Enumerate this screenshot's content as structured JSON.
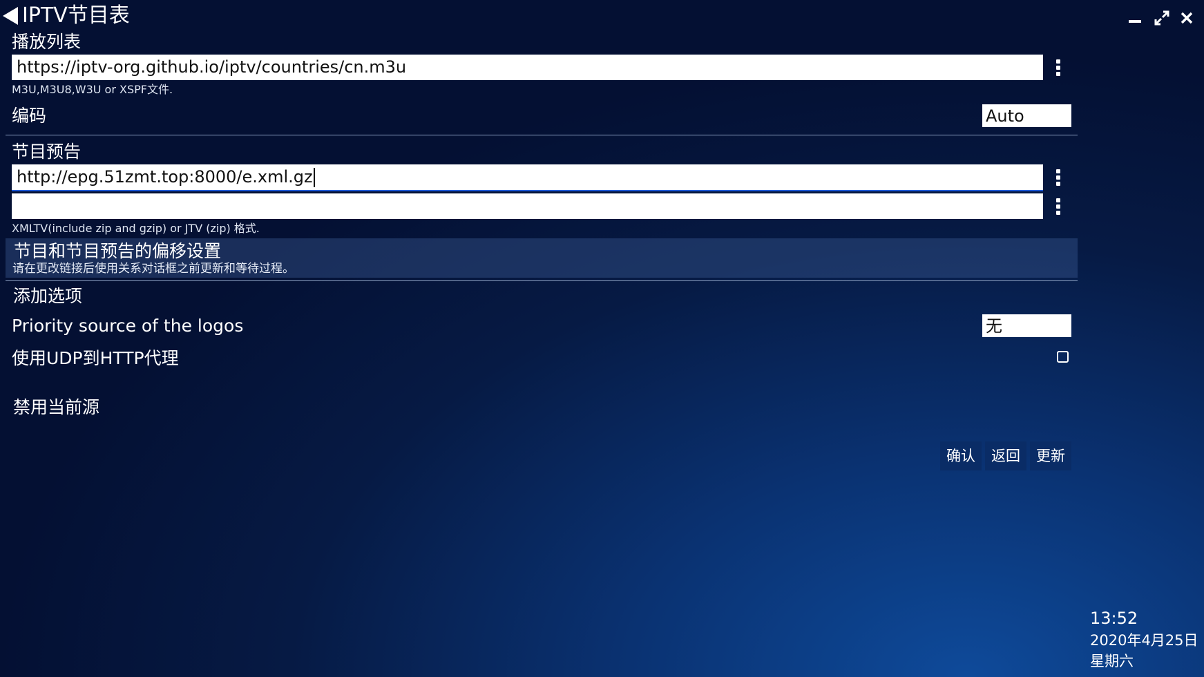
{
  "window": {
    "title": "IPTV节目表",
    "controls": [
      "minimize",
      "maximize",
      "close"
    ]
  },
  "playlist": {
    "label": "播放列表",
    "url": "https://iptv-org.github.io/iptv/countries/cn.m3u",
    "hint": "M3U,M3U8,W3U or XSPF文件."
  },
  "encoding": {
    "label": "编码",
    "value": "Auto"
  },
  "epg": {
    "label": "节目预告",
    "url1": "http://epg.51zmt.top:8000/e.xml.gz",
    "url2": "",
    "hint": "XMLTV(include zip and gzip) or JTV (zip) 格式."
  },
  "offset": {
    "title": "节目和节目预告的偏移设置",
    "subtitle": "请在更改链接后使用关系对话框之前更新和等待过程。"
  },
  "options": {
    "label": "添加选项",
    "logo_source_label": "Priority source of the logos",
    "logo_source_value": "无",
    "udp_proxy_label": "使用UDP到HTTP代理",
    "udp_proxy_checked": false
  },
  "disable_source": {
    "label": "禁用当前源"
  },
  "buttons": {
    "confirm": "确认",
    "back": "返回",
    "update": "更新"
  },
  "clock": {
    "time": "13:52",
    "date": "2020年4月25日",
    "weekday": "星期六"
  }
}
